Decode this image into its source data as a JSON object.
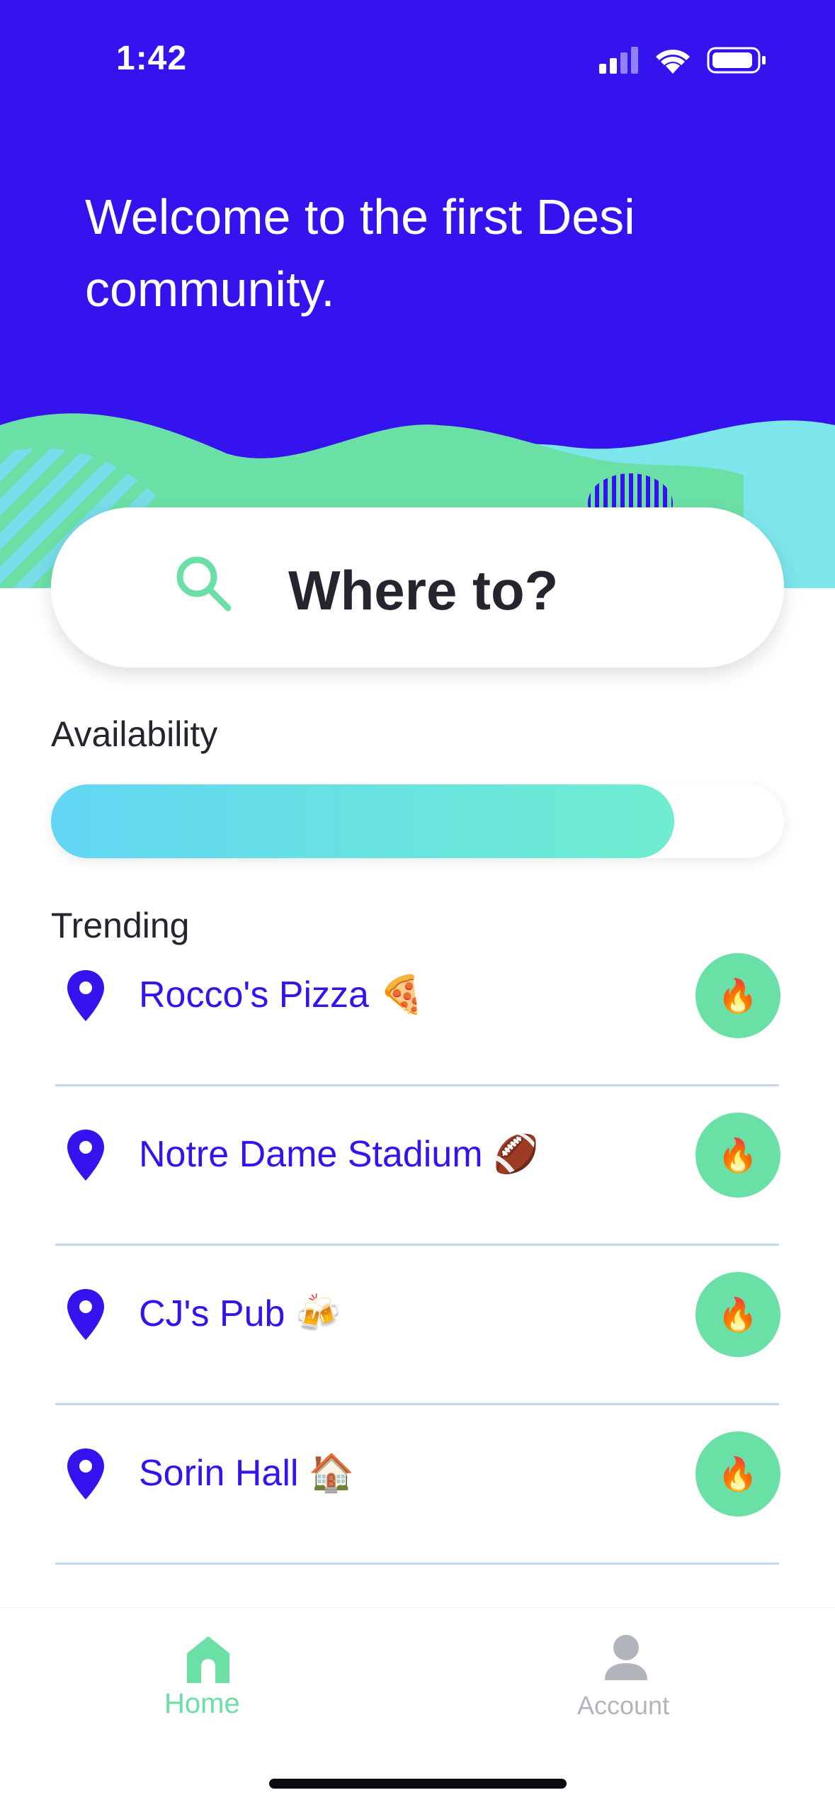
{
  "status_bar": {
    "time": "1:42"
  },
  "hero": {
    "welcome": "Welcome to the first Desi community."
  },
  "search": {
    "placeholder": "Where to?"
  },
  "availability": {
    "label": "Availability",
    "level": 0.85
  },
  "trending": {
    "label": "Trending",
    "items": [
      {
        "name": "Rocco's Pizza 🍕",
        "badge": "🔥"
      },
      {
        "name": "Notre Dame Stadium 🏈",
        "badge": "🔥"
      },
      {
        "name": "CJ's Pub 🍻",
        "badge": "🔥"
      },
      {
        "name": "Sorin Hall 🏠",
        "badge": "🔥"
      }
    ]
  },
  "tabs": {
    "home": {
      "label": "Home",
      "active": true
    },
    "account": {
      "label": "Account",
      "active": false
    }
  },
  "colors": {
    "brand": "#3413ee",
    "accent": "#6be0a6",
    "availability_start": "#62d6f4",
    "availability_end": "#6fedcf"
  }
}
